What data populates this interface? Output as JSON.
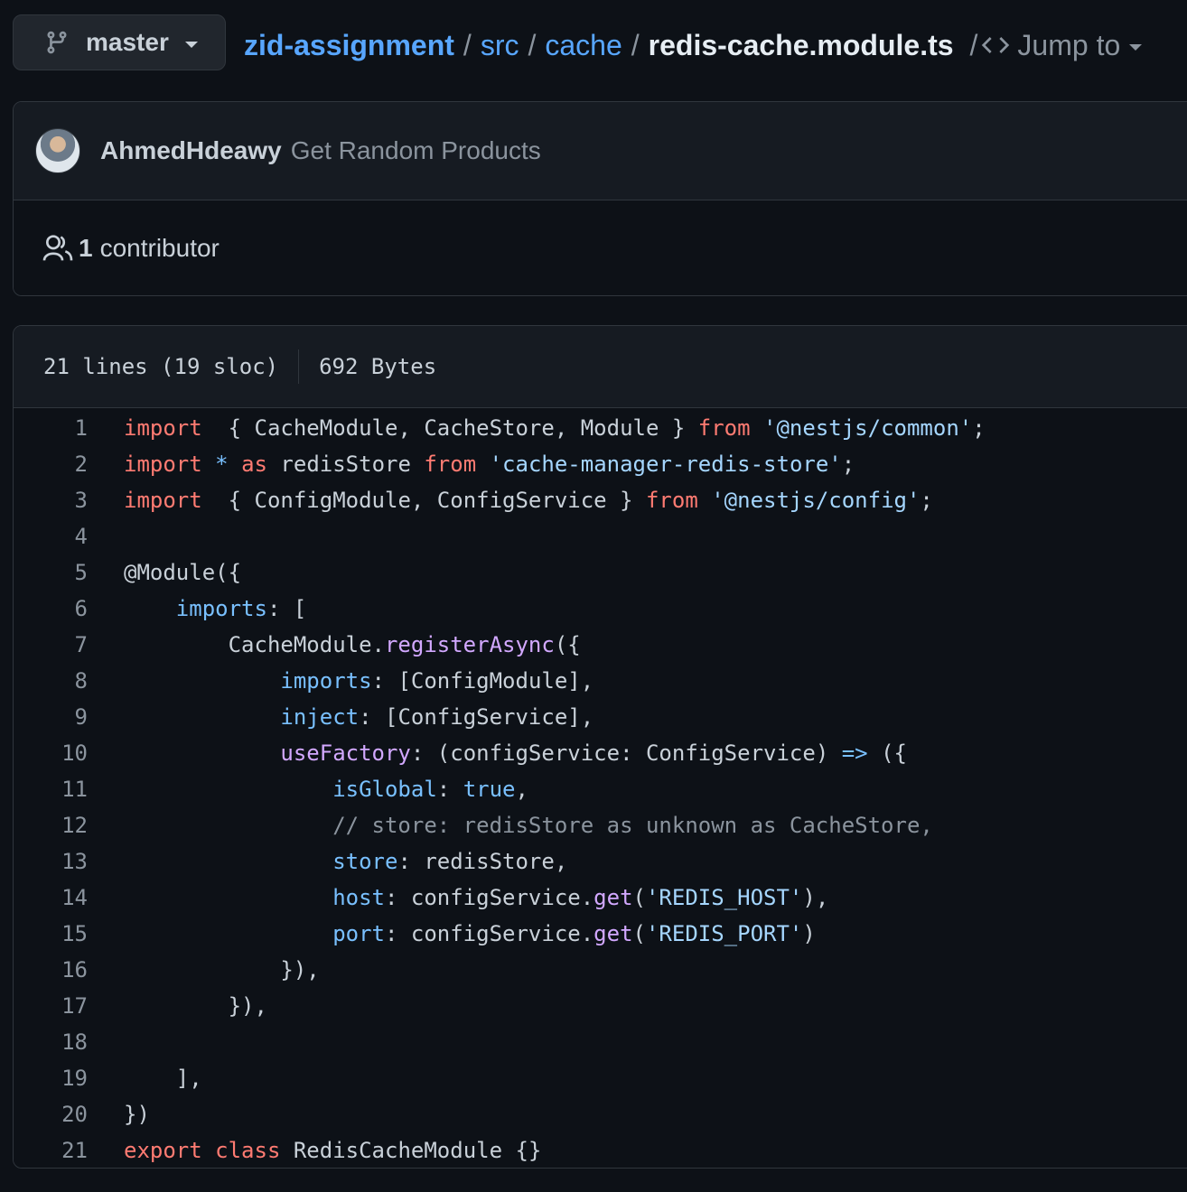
{
  "branch": {
    "label": "master"
  },
  "breadcrumb": {
    "repo": "zid-assignment",
    "sep": "/",
    "dirs": [
      "src",
      "cache"
    ],
    "file": "redis-cache.module.ts",
    "jump_label": "Jump to"
  },
  "commit": {
    "author": "AhmedHdeawy",
    "message": "Get Random Products"
  },
  "contributors": {
    "count": "1",
    "label": "contributor"
  },
  "file_info": {
    "lines": "21 lines (19 sloc)",
    "size": "692 Bytes"
  },
  "code_lines": [
    [
      [
        "kw",
        "import"
      ],
      [
        "",
        "  { CacheModule, CacheStore, Module } "
      ],
      [
        "kw",
        "from"
      ],
      [
        "",
        " "
      ],
      [
        "str",
        "'@nestjs/common'"
      ],
      [
        "",
        ";"
      ]
    ],
    [
      [
        "kw",
        "import"
      ],
      [
        "",
        " "
      ],
      [
        "op",
        "*"
      ],
      [
        "",
        " "
      ],
      [
        "kw",
        "as"
      ],
      [
        "",
        " redisStore "
      ],
      [
        "kw",
        "from"
      ],
      [
        "",
        " "
      ],
      [
        "str",
        "'cache-manager-redis-store'"
      ],
      [
        "",
        ";"
      ]
    ],
    [
      [
        "kw",
        "import"
      ],
      [
        "",
        "  { ConfigModule, ConfigService } "
      ],
      [
        "kw",
        "from"
      ],
      [
        "",
        " "
      ],
      [
        "str",
        "'@nestjs/config'"
      ],
      [
        "",
        ";"
      ]
    ],
    [],
    [
      [
        "",
        "@Module({"
      ]
    ],
    [
      [
        "",
        "    "
      ],
      [
        "prop",
        "imports"
      ],
      [
        "",
        ": ["
      ]
    ],
    [
      [
        "",
        "        CacheModule."
      ],
      [
        "fn",
        "registerAsync"
      ],
      [
        "",
        "({"
      ]
    ],
    [
      [
        "",
        "            "
      ],
      [
        "prop",
        "imports"
      ],
      [
        "",
        ": [ConfigModule],"
      ]
    ],
    [
      [
        "",
        "            "
      ],
      [
        "prop",
        "inject"
      ],
      [
        "",
        ": [ConfigService],"
      ]
    ],
    [
      [
        "",
        "            "
      ],
      [
        "fn",
        "useFactory"
      ],
      [
        "",
        ": (configService: ConfigService) "
      ],
      [
        "op",
        "=>"
      ],
      [
        "",
        " ({"
      ]
    ],
    [
      [
        "",
        "                "
      ],
      [
        "prop",
        "isGlobal"
      ],
      [
        "",
        ": "
      ],
      [
        "prop",
        "true"
      ],
      [
        "",
        ","
      ]
    ],
    [
      [
        "",
        "                "
      ],
      [
        "cm",
        "// store: redisStore as unknown as CacheStore,"
      ]
    ],
    [
      [
        "",
        "                "
      ],
      [
        "prop",
        "store"
      ],
      [
        "",
        ": redisStore,"
      ]
    ],
    [
      [
        "",
        "                "
      ],
      [
        "prop",
        "host"
      ],
      [
        "",
        ": configService."
      ],
      [
        "fn",
        "get"
      ],
      [
        "",
        "("
      ],
      [
        "str",
        "'REDIS_HOST'"
      ],
      [
        "",
        "),"
      ]
    ],
    [
      [
        "",
        "                "
      ],
      [
        "prop",
        "port"
      ],
      [
        "",
        ": configService."
      ],
      [
        "fn",
        "get"
      ],
      [
        "",
        "("
      ],
      [
        "str",
        "'REDIS_PORT'"
      ],
      [
        "",
        ")"
      ]
    ],
    [
      [
        "",
        "            }),"
      ]
    ],
    [
      [
        "",
        "        }),"
      ]
    ],
    [],
    [
      [
        "",
        "    ],"
      ]
    ],
    [
      [
        "",
        "})"
      ]
    ],
    [
      [
        "kw",
        "export"
      ],
      [
        "",
        " "
      ],
      [
        "kw",
        "class"
      ],
      [
        "",
        " RedisCacheModule {}"
      ]
    ]
  ]
}
